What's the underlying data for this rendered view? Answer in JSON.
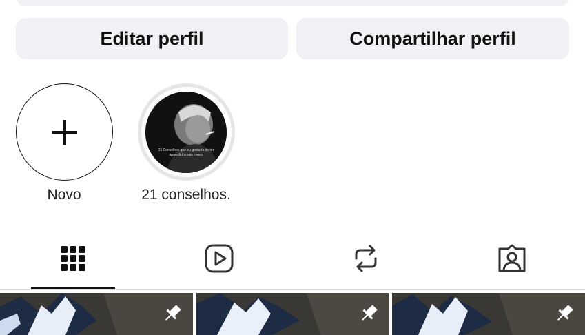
{
  "profile_actions": {
    "edit_label": "Editar perfil",
    "share_label": "Compartilhar perfil"
  },
  "highlights": [
    {
      "label": "Novo",
      "icon": "plus-icon"
    },
    {
      "label": "21 conselhos.",
      "cover_text": "21 Conselhos que eu gostaria de ter aprendido mais jovem"
    }
  ],
  "tabs": [
    {
      "name": "posts",
      "icon": "grid-icon",
      "active": true
    },
    {
      "name": "reels",
      "icon": "reels-icon",
      "active": false
    },
    {
      "name": "reposts",
      "icon": "repost-icon",
      "active": false
    },
    {
      "name": "tagged",
      "icon": "tagged-icon",
      "active": false
    }
  ],
  "posts": [
    {
      "pinned": true,
      "icon": "pin-icon"
    },
    {
      "pinned": true,
      "icon": "pin-icon"
    },
    {
      "pinned": true,
      "icon": "pin-icon"
    }
  ],
  "colors": {
    "button_bg": "#eff1f4",
    "text": "#111111",
    "story_ring": "#e6e6e6"
  }
}
